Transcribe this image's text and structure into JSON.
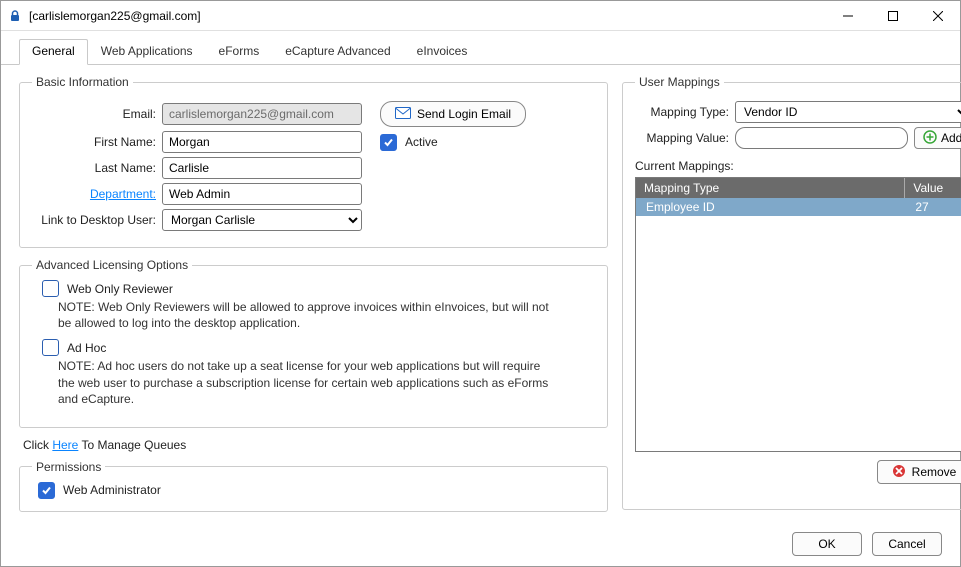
{
  "window": {
    "title": "[carlislemorgan225@gmail.com]"
  },
  "tabs": [
    {
      "label": "General"
    },
    {
      "label": "Web Applications"
    },
    {
      "label": "eForms"
    },
    {
      "label": "eCapture Advanced"
    },
    {
      "label": "eInvoices"
    }
  ],
  "basic": {
    "legend": "Basic Information",
    "email_label": "Email:",
    "email_value": "carlislemorgan225@gmail.com",
    "send_login_label": "Send Login Email",
    "first_name_label": "First Name:",
    "first_name_value": "Morgan",
    "active_label": "Active",
    "last_name_label": "Last Name:",
    "last_name_value": "Carlisle",
    "department_label": "Department:",
    "department_value": "Web Admin",
    "desktop_user_label": "Link to Desktop User:",
    "desktop_user_value": "Morgan  Carlisle"
  },
  "licensing": {
    "legend": "Advanced Licensing Options",
    "web_only_label": "Web Only Reviewer",
    "web_only_note": "NOTE: Web Only Reviewers will be allowed to approve invoices within eInvoices, but will not be allowed to log into the desktop application.",
    "adhoc_label": "Ad Hoc",
    "adhoc_note": "NOTE: Ad hoc users do not take up a seat license for your web applications but will require the web user to purchase a subscription license for certain web applications such as eForms and eCapture."
  },
  "queues": {
    "prefix": "Click ",
    "link": "Here",
    "suffix": " To Manage Queues"
  },
  "permissions": {
    "legend": "Permissions",
    "web_admin_label": "Web Administrator"
  },
  "usermappings": {
    "legend": "User Mappings",
    "type_label": "Mapping Type:",
    "type_value": "Vendor ID",
    "value_label": "Mapping Value:",
    "add_label": "Add",
    "current_label": "Current Mappings:",
    "header_type": "Mapping Type",
    "header_value": "Value",
    "rows": [
      {
        "type": "Employee ID",
        "value": "27"
      }
    ],
    "remove_label": "Remove"
  },
  "footer": {
    "ok": "OK",
    "cancel": "Cancel"
  }
}
